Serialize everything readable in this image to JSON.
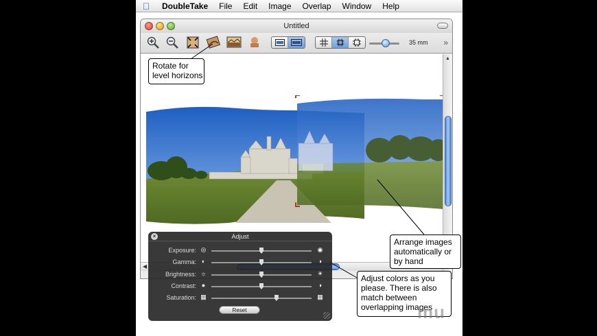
{
  "menubar": {
    "app_name": "DoubleTake",
    "items": [
      "File",
      "Edit",
      "Image",
      "Overlap",
      "Window",
      "Help"
    ]
  },
  "window": {
    "title": "Untitled"
  },
  "toolbar": {
    "zoom_value": "35 mm",
    "buttons": [
      "zoom-in-icon",
      "zoom-out-icon",
      "fit-icon",
      "rotate-icon",
      "landscape-icon",
      "stamp-icon"
    ]
  },
  "callouts": {
    "rotate": [
      "Rotate for",
      "level horizons"
    ],
    "arrange": [
      "Arrange images",
      "automatically or",
      "by hand"
    ],
    "adjust": [
      "Adjust colors as you",
      "please. There is also",
      "match between",
      "overlapping images"
    ]
  },
  "adjust_panel": {
    "title": "Adjust",
    "rows": [
      {
        "label": "Exposure:",
        "level": 0.5
      },
      {
        "label": "Gamma:",
        "level": 0.5
      },
      {
        "label": "Brightness:",
        "level": 0.5
      },
      {
        "label": "Contrast:",
        "level": 0.5
      },
      {
        "label": "Saturation:",
        "level": 0.65
      }
    ],
    "reset_label": "Reset"
  },
  "watermark": "mu"
}
